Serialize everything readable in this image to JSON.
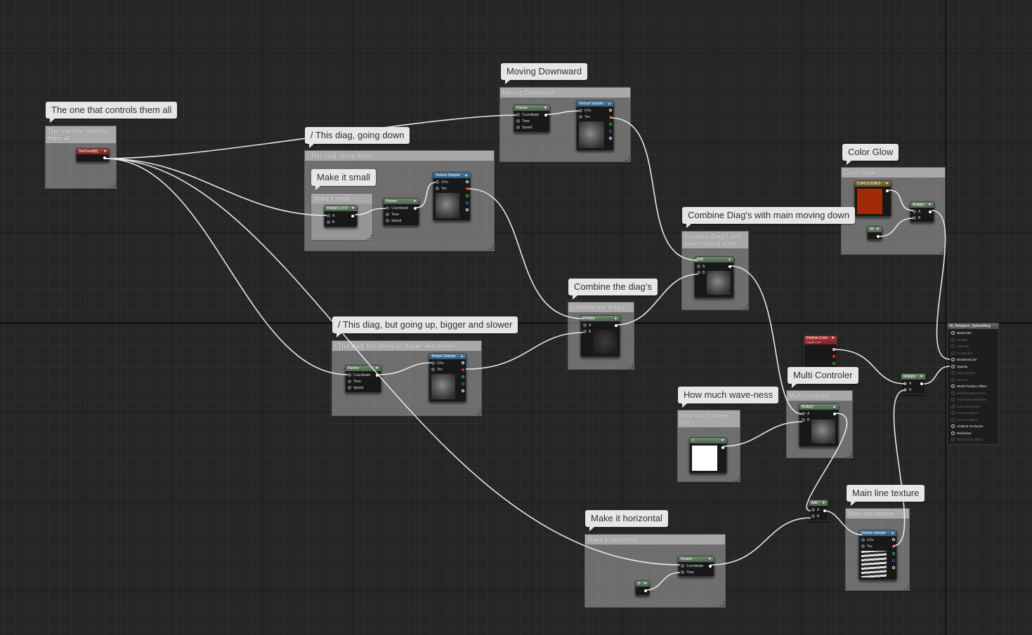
{
  "comments": {
    "controls": "The one that controls them all",
    "diag_down": "/ This diag, going down",
    "make_small": "Make it small",
    "moving_downward": "Moving Downward",
    "combine_diags": "Combine the diag's",
    "combine_main": "Combine Diag's with main moving down",
    "color_glow": "Color Glow",
    "diag_up": "/ This diag, but going up, bigger and slower",
    "wave": "How much wave-ness",
    "multi": "Multi Controler",
    "main_line": "Main line texture",
    "horizontal": "Make it horizontal"
  },
  "nodes": {
    "texcoord": "TexCoord[0]",
    "panner": "Panner",
    "texture_sample": "Texture Sample",
    "multiply": "Multiply",
    "multiply_small": "Multiply (,0.5)",
    "add": "Add",
    "rotator": "Rotator",
    "particle_color": "Particle Color",
    "particle_color_sub": "Signal Lock",
    "color_value": "0.345,0.0198,0",
    "const_30": "30",
    "const_1": "1",
    "const_0": "0"
  },
  "pins": {
    "uvs": "UVs",
    "tex": "Tex",
    "coordinate": "Coordinate",
    "time": "Time",
    "speed": "Speed",
    "a": "A",
    "b": "B"
  },
  "material": {
    "title": "M_Hologram_SphereRing",
    "inputs": [
      {
        "label": "BaseColor",
        "active": true
      },
      {
        "label": "Metallic",
        "active": false
      },
      {
        "label": "Specular",
        "active": false
      },
      {
        "label": "Roughness",
        "active": false
      },
      {
        "label": "EmissiveColor",
        "active": true
      },
      {
        "label": "Opacity",
        "active": true
      },
      {
        "label": "OpacityMask",
        "active": false
      },
      {
        "label": "Normal",
        "active": false
      },
      {
        "label": "World Position Offset",
        "active": true
      },
      {
        "label": "World Displacement",
        "active": false
      },
      {
        "label": "Tessellation Multiplier",
        "active": false
      },
      {
        "label": "SubsurfaceColor",
        "active": false
      },
      {
        "label": "Custom Data 0",
        "active": false
      },
      {
        "label": "Custom Data 1",
        "active": false
      },
      {
        "label": "Ambient Occlusion",
        "active": true
      },
      {
        "label": "Refraction",
        "active": true
      },
      {
        "label": "Pixel Depth Offset",
        "active": false
      }
    ]
  }
}
